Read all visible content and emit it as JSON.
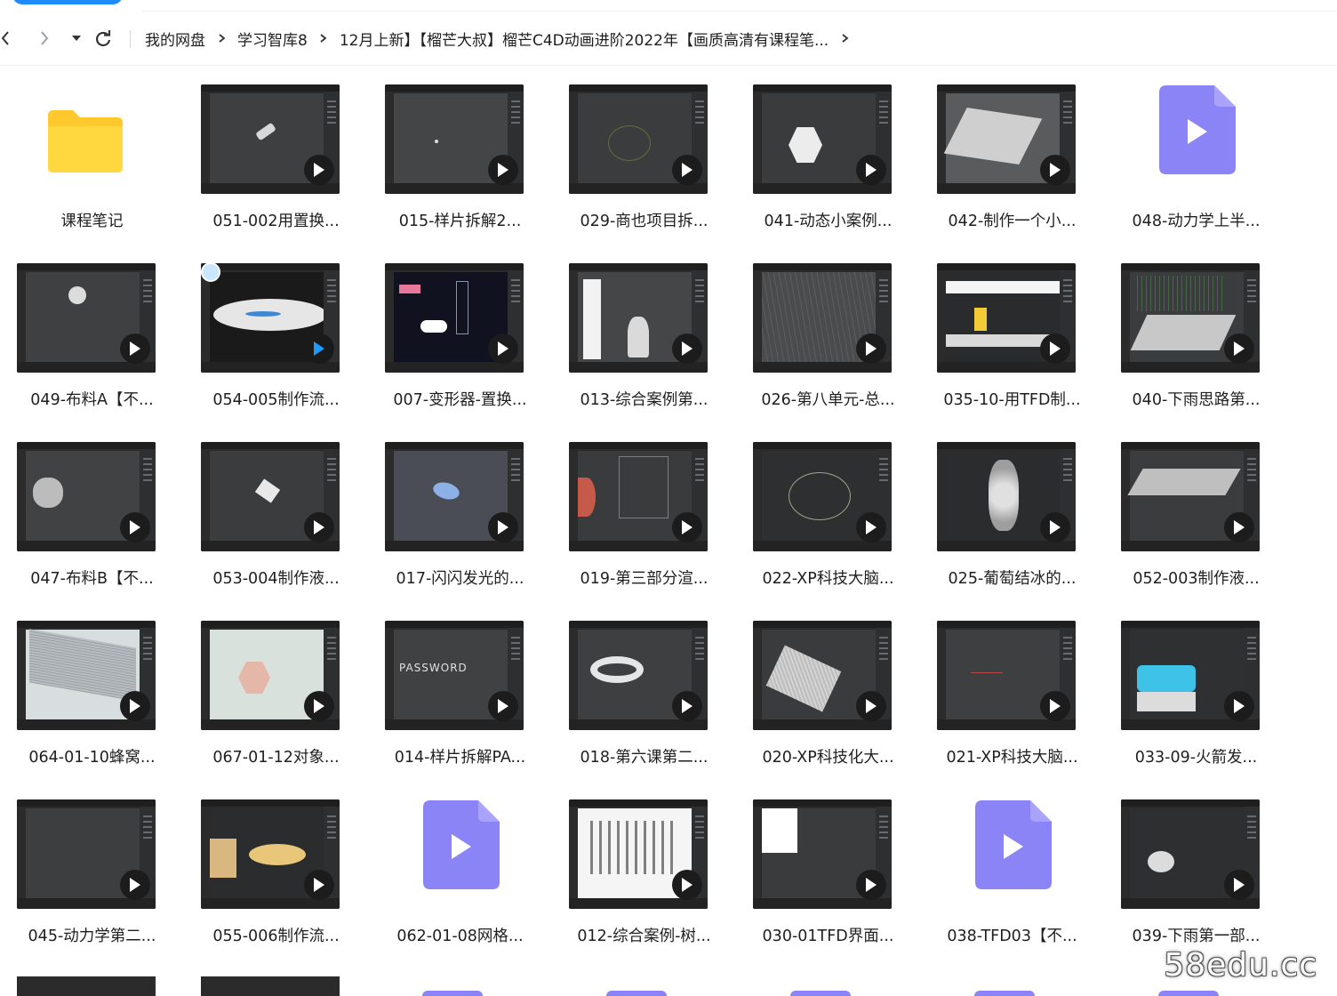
{
  "nav": {
    "breadcrumbs": [
      "我的网盘",
      "学习智库8",
      "12月上新】【榴芒大叔】榴芒C4D动画进阶2022年【画质高清有课程笔..."
    ]
  },
  "colors": {
    "accent": "#1e8bff",
    "video_icon": "#8b84f6",
    "folder": "#ffd43b"
  },
  "files": [
    {
      "name": "课程笔记",
      "type": "folder"
    },
    {
      "name": "051-002用置换...",
      "type": "video"
    },
    {
      "name": "015-样片拆解2...",
      "type": "video"
    },
    {
      "name": "029-商也项目拆...",
      "type": "video"
    },
    {
      "name": "041-动态小案例...",
      "type": "video"
    },
    {
      "name": "042-制作一个小...",
      "type": "video"
    },
    {
      "name": "048-动力学上半...",
      "type": "video-file"
    },
    {
      "name": "049-布料A【不...",
      "type": "video"
    },
    {
      "name": "054-005制作流...",
      "type": "video"
    },
    {
      "name": "007-变形器-置换...",
      "type": "video"
    },
    {
      "name": "013-综合案例第...",
      "type": "video"
    },
    {
      "name": "026-第八单元-总...",
      "type": "video"
    },
    {
      "name": "035-10-用TFD制...",
      "type": "video"
    },
    {
      "name": "040-下雨思路第...",
      "type": "video"
    },
    {
      "name": "047-布料B【不...",
      "type": "video"
    },
    {
      "name": "053-004制作液...",
      "type": "video"
    },
    {
      "name": "017-闪闪发光的...",
      "type": "video"
    },
    {
      "name": "019-第三部分渲...",
      "type": "video"
    },
    {
      "name": "022-XP科技大脑...",
      "type": "video"
    },
    {
      "name": "025-葡萄结冰的...",
      "type": "video"
    },
    {
      "name": "052-003制作液...",
      "type": "video"
    },
    {
      "name": "064-01-10蜂窝...",
      "type": "video"
    },
    {
      "name": "067-01-12对象...",
      "type": "video"
    },
    {
      "name": "014-样片拆解PA...",
      "type": "video"
    },
    {
      "name": "018-第六课第二...",
      "type": "video"
    },
    {
      "name": "020-XP科技化大...",
      "type": "video"
    },
    {
      "name": "021-XP科技大脑...",
      "type": "video"
    },
    {
      "name": "033-09-火箭发...",
      "type": "video"
    },
    {
      "name": "045-动力学第二...",
      "type": "video"
    },
    {
      "name": "055-006制作流...",
      "type": "video"
    },
    {
      "name": "062-01-08网格...",
      "type": "video-file"
    },
    {
      "name": "012-综合案例-树...",
      "type": "video"
    },
    {
      "name": "030-01TFD界面...",
      "type": "video"
    },
    {
      "name": "038-TFD03【不...",
      "type": "video-file"
    },
    {
      "name": "039-下雨第一部...",
      "type": "video"
    }
  ],
  "thumb_texts": {
    "password": "PASSWORD"
  },
  "watermark": "58edu.cc"
}
